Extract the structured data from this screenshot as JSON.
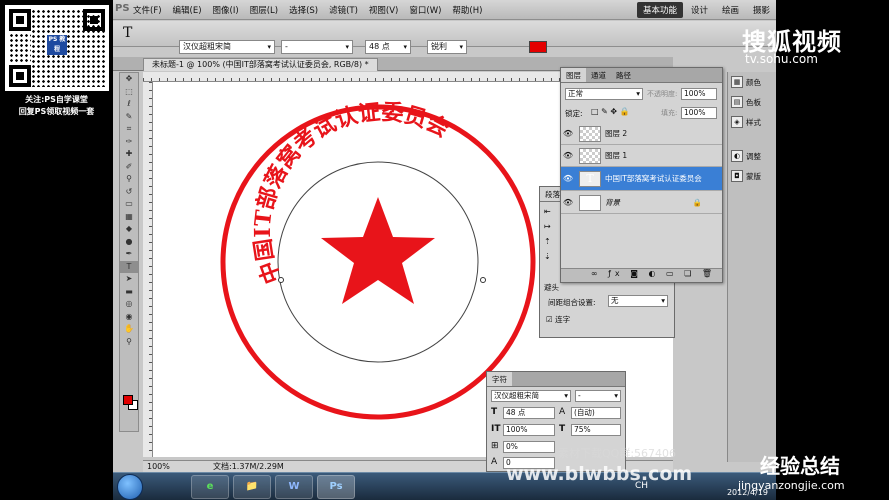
{
  "promo": {
    "qr_logo": "PS\n教程",
    "line1": "关注:PS自学课堂",
    "line2": "回复PS领取视频一套"
  },
  "app": {
    "logo": "PS",
    "menu": [
      "文件(F)",
      "编辑(E)",
      "图像(I)",
      "图层(L)",
      "选择(S)",
      "滤镜(T)",
      "视图(V)",
      "窗口(W)",
      "帮助(H)"
    ],
    "zoom": "100%",
    "workspaces": [
      "基本功能",
      "设计",
      "绘画",
      "摄影"
    ]
  },
  "options_bar": {
    "tool_icon": "T",
    "font_family": "汉仪超粗宋简",
    "font_style": "-",
    "font_size": "48 点",
    "anti_alias": "锐利",
    "color": "#e40000"
  },
  "document": {
    "tab_title": "未标题-1 @ 100% (中国IT部落窝考试认证委员会, RGB/8) *",
    "seal_text": "中国IT部落窝考试认证委员会",
    "seal_color": "#e8141a",
    "status_zoom": "100%",
    "status_doc": "文档:1.37M/2.29M"
  },
  "layers_panel": {
    "tabs": [
      "图层",
      "通道",
      "路径"
    ],
    "blend_mode": "正常",
    "opacity_label": "不透明度:",
    "opacity": "100%",
    "lock_label": "锁定:",
    "fill_label": "填充:",
    "fill": "100%",
    "layers": [
      {
        "name": "图层 2",
        "kind": "pixel"
      },
      {
        "name": "图层 1",
        "kind": "pixel"
      },
      {
        "name": "中国IT部落窝考试认证委员会",
        "kind": "text",
        "selected": true
      },
      {
        "name": "背景",
        "kind": "background"
      }
    ]
  },
  "paragraph_panel": {
    "tab": "段落",
    "avoid_label": "避头",
    "spacing_label": "间距组合设置:",
    "spacing_value": "无",
    "hyphen_label": "连字"
  },
  "char_panel": {
    "tab": "字符",
    "font": "汉仪超粗宋简",
    "style": "-",
    "size": "48 点",
    "leading": "(自动)",
    "vscale": "100%",
    "hscale": "75%",
    "tracking": "0%",
    "baseline": "0"
  },
  "dock": [
    "颜色",
    "色板",
    "样式",
    "调整",
    "蒙版"
  ],
  "branding": {
    "sohu": "搜狐视频",
    "sohu_url": "tv.sohu.com",
    "watermark_small": "素材下载QQ群:567406",
    "watermark_big": "www.blwbbs.com",
    "jy_big": "经验总结",
    "jy_url": "jingyanzongjie.com"
  },
  "taskbar": {
    "apps": [
      "e",
      "📁",
      "W",
      "Ps"
    ],
    "tray": "CH",
    "date": "2012/4/19"
  }
}
